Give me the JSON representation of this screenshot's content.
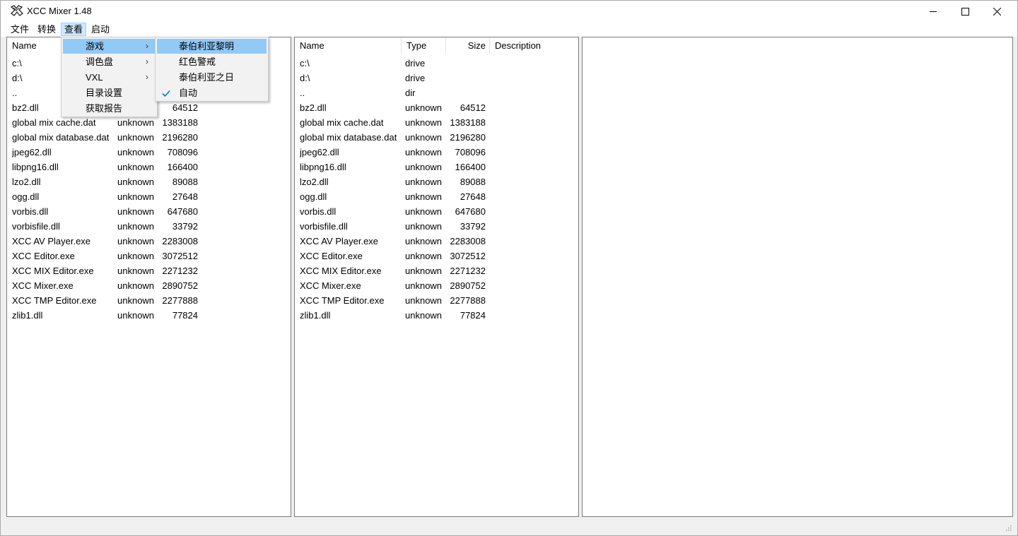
{
  "window": {
    "title": "XCC Mixer 1.48"
  },
  "menubar": {
    "items": [
      "文件",
      "转换",
      "查看",
      "启动"
    ]
  },
  "panels": {
    "left": {
      "headers": [
        "Name"
      ],
      "rows": [
        {
          "name": "c:\\",
          "type": "",
          "size": ""
        },
        {
          "name": "d:\\",
          "type": "",
          "size": ""
        },
        {
          "name": "..",
          "type": "",
          "size": ""
        },
        {
          "name": "bz2.dll",
          "type": "",
          "size": "64512"
        },
        {
          "name": "global mix cache.dat",
          "type": "unknown",
          "size": "1383188"
        },
        {
          "name": "global mix database.dat",
          "type": "unknown",
          "size": "2196280"
        },
        {
          "name": "jpeg62.dll",
          "type": "unknown",
          "size": "708096"
        },
        {
          "name": "libpng16.dll",
          "type": "unknown",
          "size": "166400"
        },
        {
          "name": "lzo2.dll",
          "type": "unknown",
          "size": "89088"
        },
        {
          "name": "ogg.dll",
          "type": "unknown",
          "size": "27648"
        },
        {
          "name": "vorbis.dll",
          "type": "unknown",
          "size": "647680"
        },
        {
          "name": "vorbisfile.dll",
          "type": "unknown",
          "size": "33792"
        },
        {
          "name": "XCC AV Player.exe",
          "type": "unknown",
          "size": "2283008"
        },
        {
          "name": "XCC Editor.exe",
          "type": "unknown",
          "size": "3072512"
        },
        {
          "name": "XCC MIX Editor.exe",
          "type": "unknown",
          "size": "2271232"
        },
        {
          "name": "XCC Mixer.exe",
          "type": "unknown",
          "size": "2890752"
        },
        {
          "name": "XCC TMP Editor.exe",
          "type": "unknown",
          "size": "2277888"
        },
        {
          "name": "zlib1.dll",
          "type": "unknown",
          "size": "77824"
        }
      ]
    },
    "middle": {
      "headers": [
        "Name",
        "Type",
        "Size",
        "Description"
      ],
      "rows": [
        {
          "name": "c:\\",
          "type": "drive",
          "size": ""
        },
        {
          "name": "d:\\",
          "type": "drive",
          "size": ""
        },
        {
          "name": "..",
          "type": "dir",
          "size": ""
        },
        {
          "name": "bz2.dll",
          "type": "unknown",
          "size": "64512"
        },
        {
          "name": "global mix cache.dat",
          "type": "unknown",
          "size": "1383188"
        },
        {
          "name": "global mix database.dat",
          "type": "unknown",
          "size": "2196280"
        },
        {
          "name": "jpeg62.dll",
          "type": "unknown",
          "size": "708096"
        },
        {
          "name": "libpng16.dll",
          "type": "unknown",
          "size": "166400"
        },
        {
          "name": "lzo2.dll",
          "type": "unknown",
          "size": "89088"
        },
        {
          "name": "ogg.dll",
          "type": "unknown",
          "size": "27648"
        },
        {
          "name": "vorbis.dll",
          "type": "unknown",
          "size": "647680"
        },
        {
          "name": "vorbisfile.dll",
          "type": "unknown",
          "size": "33792"
        },
        {
          "name": "XCC AV Player.exe",
          "type": "unknown",
          "size": "2283008"
        },
        {
          "name": "XCC Editor.exe",
          "type": "unknown",
          "size": "3072512"
        },
        {
          "name": "XCC MIX Editor.exe",
          "type": "unknown",
          "size": "2271232"
        },
        {
          "name": "XCC Mixer.exe",
          "type": "unknown",
          "size": "2890752"
        },
        {
          "name": "XCC TMP Editor.exe",
          "type": "unknown",
          "size": "2277888"
        },
        {
          "name": "zlib1.dll",
          "type": "unknown",
          "size": "77824"
        }
      ]
    }
  },
  "view_menu": {
    "items": [
      "游戏",
      "调色盘",
      "VXL",
      "目录设置",
      "获取报告"
    ]
  },
  "game_submenu": {
    "items": [
      "泰伯利亚黎明",
      "红色警戒",
      "泰伯利亚之日",
      "自动"
    ]
  },
  "colors": {
    "menu_highlight": "#91c9f7",
    "menubar_active": "#cce8ff",
    "check": "#0078d7"
  }
}
